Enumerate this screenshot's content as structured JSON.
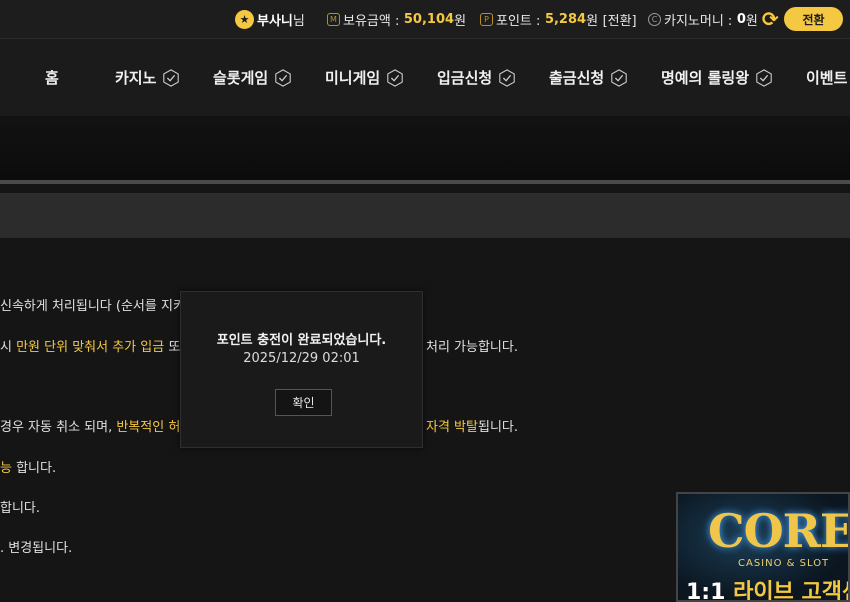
{
  "topbar": {
    "username": "부사니",
    "username_suffix": "님",
    "balance_label": "보유금액 :",
    "balance_value": "50,104",
    "balance_unit": "원",
    "points_label": "포인트 :",
    "points_value": "5,284",
    "points_unit": "원",
    "points_convert": "[전환]",
    "casino_money_label": "카지노머니 :",
    "casino_money_value": "0",
    "casino_money_unit": "원",
    "convert_button": "전환",
    "balance_icon_letter": "M",
    "points_icon_letter": "P",
    "casino_icon_letter": "C"
  },
  "nav": {
    "items": [
      {
        "label": "홈"
      },
      {
        "label": "카지노"
      },
      {
        "label": "슬롯게임"
      },
      {
        "label": "미니게임"
      },
      {
        "label": "입금신청"
      },
      {
        "label": "출금신청"
      },
      {
        "label": "명예의 롤링왕"
      },
      {
        "label": "이벤트"
      }
    ]
  },
  "content": {
    "line1": "신속하게 처리됩니다 (순서를 지키",
    "line2_a": "시 ",
    "line2_highlight": "만원 단위 맞춰서 추가 입금",
    "line2_b": " 또",
    "line2_c": " 처리 가능합니다.",
    "line3_a": "경우 자동 취소 되며, ",
    "line3_highlight": "반복적인 허",
    "line3_highlight2": "자격 박탈",
    "line3_b": "됩니다.",
    "line4_highlight": "능",
    "line4_b": " 합니다.",
    "line5": "합니다.",
    "line6": ". 변경됩니다."
  },
  "modal": {
    "title": "포인트 충전이 완료되었습니다.",
    "time": "2025/12/29 02:01",
    "confirm_button": "확인"
  },
  "banner": {
    "logo": "CORE",
    "subtitle": "CASINO & SLOT",
    "text_a": "1:1 ",
    "text_b": "라이브 고객센"
  },
  "colors": {
    "accent": "#f5c842",
    "background": "#151515"
  }
}
